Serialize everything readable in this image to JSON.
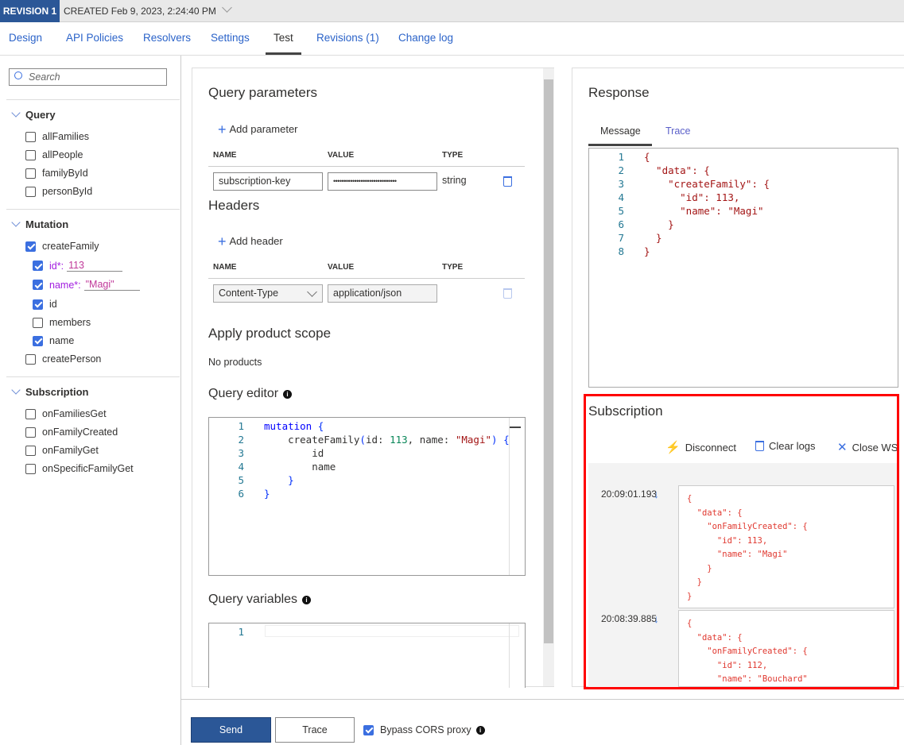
{
  "header": {
    "revision": "REVISION 1",
    "created": "CREATED Feb 9, 2023, 2:24:40 PM"
  },
  "tabs": [
    {
      "label": "Design"
    },
    {
      "label": "API Policies"
    },
    {
      "label": "Resolvers"
    },
    {
      "label": "Settings"
    },
    {
      "label": "Test",
      "active": true
    },
    {
      "label": "Revisions (1)"
    },
    {
      "label": "Change log"
    }
  ],
  "sidebar": {
    "search_placeholder": "Search",
    "query": {
      "title": "Query",
      "items": [
        "allFamilies",
        "allPeople",
        "familyById",
        "personById"
      ]
    },
    "mutation": {
      "title": "Mutation",
      "createFamily": "createFamily",
      "arg_id": "id*:",
      "arg_id_value": "113",
      "arg_name": "name*:",
      "arg_name_value": "\"Magi\"",
      "field_id": "id",
      "field_members": "members",
      "field_name": "name",
      "createPerson": "createPerson"
    },
    "subscription": {
      "title": "Subscription",
      "items": [
        "onFamiliesGet",
        "onFamilyCreated",
        "onFamilyGet",
        "onSpecificFamilyGet"
      ]
    }
  },
  "request": {
    "query_params_title": "Query parameters",
    "add_parameter": "Add parameter",
    "col_name": "NAME",
    "col_value": "VALUE",
    "col_type": "TYPE",
    "param_name": "subscription-key",
    "param_value": "••••••••••••••••••••••••••••••",
    "param_type": "string",
    "headers_title": "Headers",
    "add_header": "Add header",
    "header_name": "Content-Type",
    "header_value": "application/json",
    "scope_title": "Apply product scope",
    "scope_value": "No products",
    "editor_title": "Query editor",
    "editor_lines": [
      "mutation {",
      "    createFamily(id: 113, name: \"Magi\") {",
      "        id",
      "        name",
      "    }",
      "}"
    ],
    "variables_title": "Query variables",
    "variables_lines": [
      ""
    ]
  },
  "response": {
    "title": "Response",
    "tabs": [
      "Message",
      "Trace"
    ],
    "lines": [
      "{",
      "  \"data\": {",
      "    \"createFamily\": {",
      "      \"id\": 113,",
      "      \"name\": \"Magi\"",
      "    }",
      "  }",
      "}"
    ]
  },
  "subscription": {
    "title": "Subscription",
    "disconnect": "Disconnect",
    "clear_logs": "Clear logs",
    "close_ws": "Close WS",
    "logs": [
      {
        "time": "20:09:01.193",
        "lines": [
          "{",
          "  \"data\": {",
          "    \"onFamilyCreated\": {",
          "      \"id\": 113,",
          "      \"name\": \"Magi\"",
          "    }",
          "  }",
          "}"
        ]
      },
      {
        "time": "20:08:39.885",
        "lines": [
          "{",
          "  \"data\": {",
          "    \"onFamilyCreated\": {",
          "      \"id\": 112,",
          "      \"name\": \"Bouchard\""
        ]
      }
    ]
  },
  "footer": {
    "send": "Send",
    "trace": "Trace",
    "bypass_cors": "Bypass CORS proxy",
    "bypass_checked": true
  },
  "colors": {
    "brand": "#2b5797",
    "link": "#2b63c9",
    "highlight": "#ff0000"
  }
}
